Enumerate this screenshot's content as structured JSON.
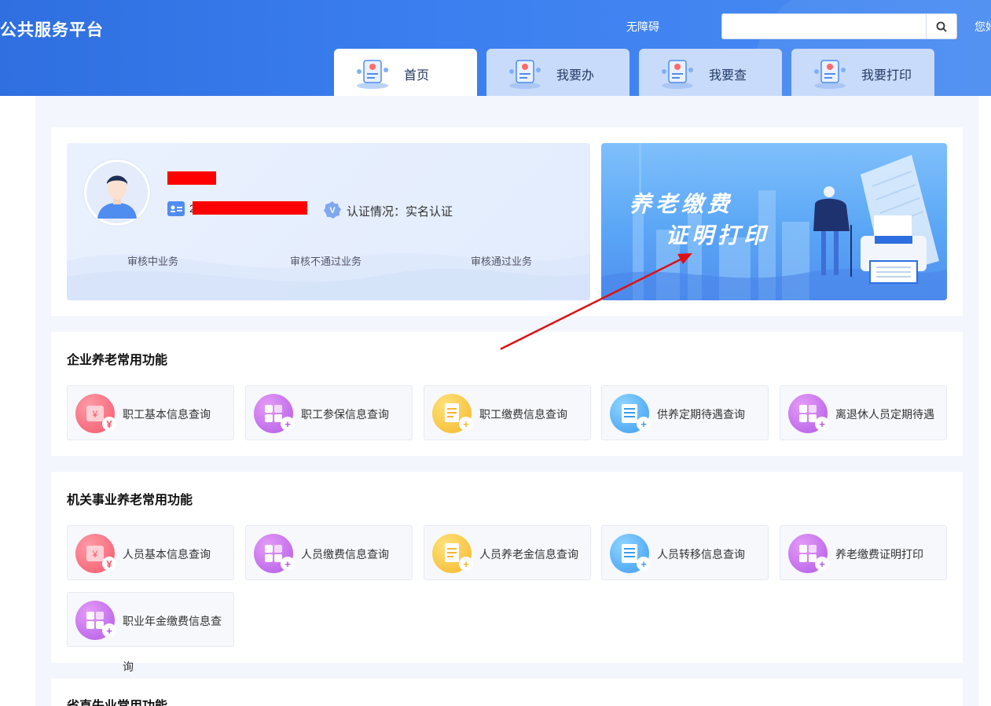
{
  "header": {
    "brand": "公共服务平台",
    "accessibility": "无障碍",
    "search_value": "",
    "greeting": "您好",
    "tabs": [
      {
        "label": "首页",
        "active": true
      },
      {
        "label": "我要办",
        "active": false
      },
      {
        "label": "我要查",
        "active": false
      },
      {
        "label": "我要打印",
        "active": false
      }
    ]
  },
  "profile": {
    "id_visible_prefix": "2",
    "auth_text": "认证情况：实名认证",
    "stats": [
      "审核中业务",
      "审核不通过业务",
      "审核通过业务"
    ]
  },
  "banner": {
    "line1": "养老缴费",
    "line2": "证明打印"
  },
  "sections": [
    {
      "title": "企业养老常用功能",
      "items": [
        {
          "label": "职工基本信息查询",
          "color": "red",
          "icon": "yen-ticket-icon"
        },
        {
          "label": "职工参保信息查询",
          "color": "purple",
          "icon": "grid-apps-icon"
        },
        {
          "label": "职工缴费信息查询",
          "color": "yellow",
          "icon": "document-list-icon"
        },
        {
          "label": "供养定期待遇查询",
          "color": "blue",
          "icon": "scroll-list-icon"
        },
        {
          "label": "离退休人员定期待遇",
          "color": "purple",
          "icon": "grid-apps-icon"
        }
      ]
    },
    {
      "title": "机关事业养老常用功能",
      "items": [
        {
          "label": "人员基本信息查询",
          "color": "red",
          "icon": "yen-ticket-icon"
        },
        {
          "label": "人员缴费信息查询",
          "color": "purple",
          "icon": "grid-apps-icon"
        },
        {
          "label": "人员养老金信息查询",
          "color": "yellow",
          "icon": "document-list-icon"
        },
        {
          "label": "人员转移信息查询",
          "color": "blue",
          "icon": "scroll-list-icon"
        },
        {
          "label": "养老缴费证明打印",
          "color": "purple",
          "icon": "grid-apps-icon"
        },
        {
          "label": "职业年金缴费信息查",
          "overflow": "询",
          "color": "purple",
          "icon": "grid-apps-icon"
        }
      ]
    },
    {
      "title": "省直失业常用功能"
    }
  ],
  "colors": {
    "header_blue": "#3b7ff0",
    "annotation_arrow": "#e01010"
  }
}
